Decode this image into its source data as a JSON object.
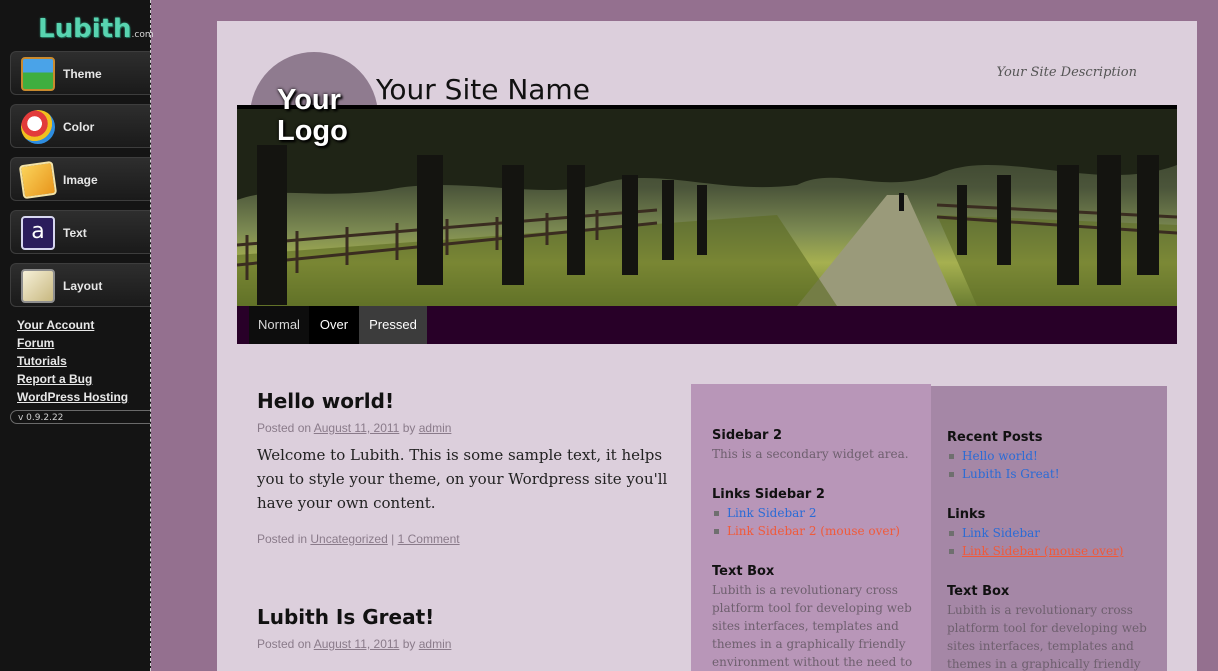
{
  "lubith": {
    "brand": "Lubith",
    "brand_suffix": ".com",
    "version": "v 0.9.2.22"
  },
  "tools": [
    {
      "label": "Theme",
      "icon": "theme-icon"
    },
    {
      "label": "Color",
      "icon": "color-icon"
    },
    {
      "label": "Image",
      "icon": "image-icon"
    },
    {
      "label": "Text",
      "icon": "text-icon"
    },
    {
      "label": "Layout",
      "icon": "layout-icon"
    }
  ],
  "panel_links": [
    "Your Account",
    "Forum",
    "Tutorials",
    "Report a Bug",
    "WordPress Hosting"
  ],
  "site": {
    "logo_text": "Your Logo",
    "name": "Your Site Name",
    "description": "Your Site Description"
  },
  "menu": {
    "normal": "Normal",
    "over": "Over",
    "pressed": "Pressed"
  },
  "posts": [
    {
      "title": "Hello world!",
      "posted_on": "Posted on",
      "date": "August 11, 2011",
      "by": "by",
      "author": "admin",
      "body": "Welcome to Lubith. This is some sample text, it helps you to style your theme, on your Wordpress site you'll have your own content.",
      "posted_in": "Posted in",
      "category": "Uncategorized",
      "sep": "|",
      "comments": "1 Comment"
    },
    {
      "title": "Lubith Is Great!",
      "posted_on": "Posted on",
      "date": "August 11, 2011",
      "by": "by",
      "author": "admin"
    }
  ],
  "sidebar2": {
    "w1_title": "Sidebar 2",
    "w1_text": "This is a secondary widget area.",
    "w2_title": "Links Sidebar 2",
    "w2_link1": "Link Sidebar 2",
    "w2_link2": "Link Sidebar 2 (mouse over)",
    "w3_title": "Text Box",
    "w3_text": "Lubith is a revolutionary cross platform tool for developing web sites interfaces, templates and themes in a graphically friendly environment without the need to write in html or"
  },
  "sidebar1": {
    "w1_title": "Recent Posts",
    "w1_link1": "Hello world!",
    "w1_link2": "Lubith Is Great!",
    "w2_title": "Links",
    "w2_link1": "Link Sidebar",
    "w2_link2": "Link Sidebar (mouse over)",
    "w3_title": "Text Box",
    "w3_text": "Lubith is a revolutionary cross platform tool for developing web sites interfaces, templates and themes in a graphically friendly environment"
  },
  "colors": {
    "panel": "#141414",
    "page": "#dccfdc",
    "outer": "#94708f",
    "menubar": "#280028",
    "sidebar2": "#b896b8",
    "sidebar1": "#a587a6",
    "link": "#2a6bd6",
    "link_hover": "#f05a3a"
  }
}
